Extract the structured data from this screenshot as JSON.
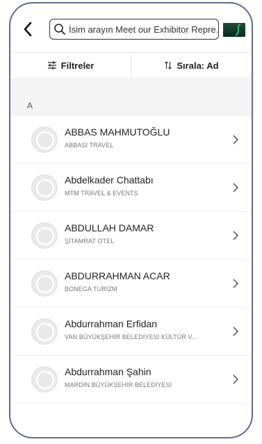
{
  "search": {
    "placeholder": "İsim arayın Meet our Exhibitor Repre..."
  },
  "actions": {
    "filter_label": "Filtreler",
    "sort_label": "Sırala: Ad"
  },
  "section": {
    "letter": "A"
  },
  "contacts": [
    {
      "name": "ABBAS MAHMUTOĞLU",
      "company": "ABBASİ TRAVEL"
    },
    {
      "name": "Abdelkader Chattabı",
      "company": "MTM TRAVEL & EVENTS"
    },
    {
      "name": "ABDULLAH DAMAR",
      "company": "ŞİTAMRAT OTEL"
    },
    {
      "name": "ABDURRAHMAN ACAR",
      "company": "BONEGA TURİZM"
    },
    {
      "name": "Abdurrahman Erfidan",
      "company": "VAN BÜYÜKŞEHİR BELEDİYESİ KÜLTÜR V..."
    },
    {
      "name": "Abdurrahman Şahin",
      "company": "MARDİN BÜYÜKŞEHİR BELEDİYESİ"
    }
  ],
  "colors": {
    "frame": "#5d6b8f",
    "section_bg": "#f4f4f4",
    "logo": "#1d4c3a"
  }
}
